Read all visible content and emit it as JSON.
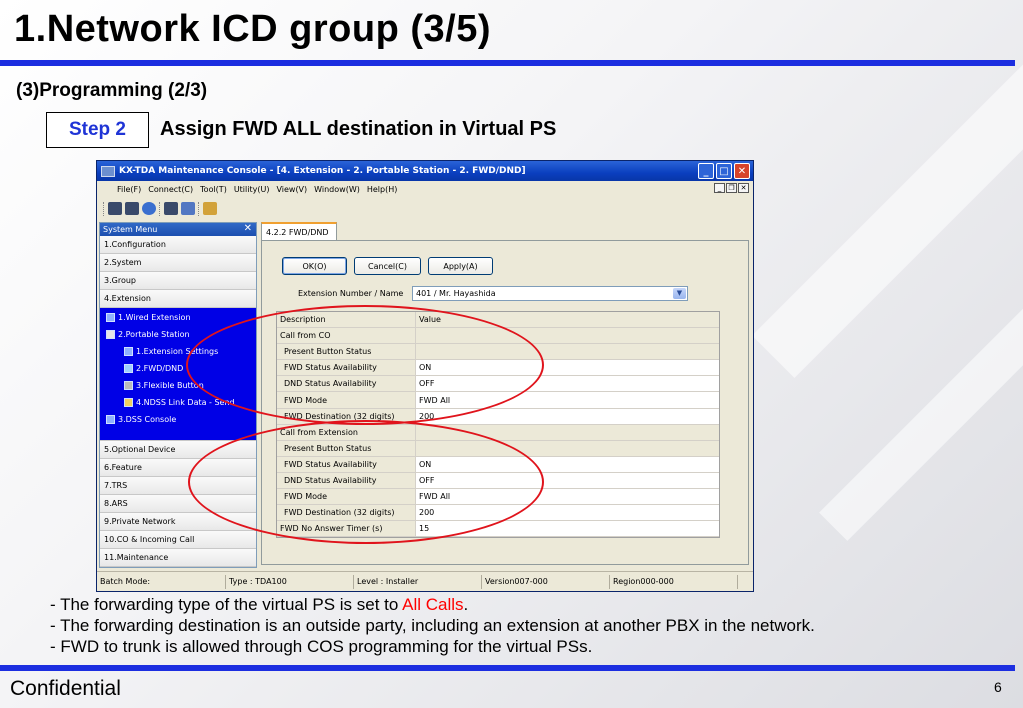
{
  "slide": {
    "title": "1.Network ICD group (3/5)",
    "subtitle": "(3)Programming (2/3)",
    "step_label": "Step 2",
    "step_text": "Assign FWD ALL destination in Virtual PS",
    "note_1_prefix": "- The forwarding type of the virtual PS is set to ",
    "note_1_highlight": "All Calls",
    "note_1_suffix": ".",
    "note_2": "- The forwarding destination is an outside party, including an extension at another PBX in the network.",
    "note_3": "- FWD to trunk is allowed through COS programming for the virtual PSs.",
    "footer": "Confidential",
    "page_number": "6",
    "accent_color": "#1c2ee0",
    "highlight_color": "#ff0000"
  },
  "window": {
    "title": "KX-TDA Maintenance Console - [4. Extension - 2. Portable Station - 2. FWD/DND]",
    "menu": [
      "File(F)",
      "Connect(C)",
      "Tool(T)",
      "Utility(U)",
      "View(V)",
      "Window(W)",
      "Help(H)"
    ],
    "toolbar_icons": [
      "connect-icon",
      "disconnect-icon",
      "settings-icon",
      "save-icon",
      "user-icon",
      "exit-icon"
    ]
  },
  "sidebar": {
    "header": "System Menu",
    "items_top": [
      "1.Configuration",
      "2.System",
      "3.Group",
      "4.Extension"
    ],
    "tree": {
      "wired": "1.Wired Extension",
      "portable": "2.Portable Station",
      "ext_settings": "1.Extension Settings",
      "fwd_dnd": "2.FWD/DND",
      "flexible": "3.Flexible Button",
      "ndss": "4.NDSS Link Data - Send",
      "dss": "3.DSS Console"
    },
    "items_bottom": [
      "5.Optional Device",
      "6.Feature",
      "7.TRS",
      "8.ARS",
      "9.Private Network",
      "10.CO & Incoming Call",
      "11.Maintenance"
    ]
  },
  "content": {
    "tab": "4.2.2 FWD/DND",
    "ok": "OK(O)",
    "cancel": "Cancel(C)",
    "apply": "Apply(A)",
    "ext_label": "Extension Number / Name",
    "ext_value": "401 / Mr. Hayashida",
    "grid_headers": {
      "description": "Description",
      "value": "Value"
    },
    "rows": [
      {
        "d": "Call from CO",
        "v": "",
        "kind": "group"
      },
      {
        "d": "Present Button Status",
        "v": "",
        "kind": "sub"
      },
      {
        "d": "FWD Status Availability",
        "v": "ON",
        "kind": "item"
      },
      {
        "d": "DND Status Availability",
        "v": "OFF",
        "kind": "item"
      },
      {
        "d": "FWD Mode",
        "v": "FWD All",
        "kind": "item"
      },
      {
        "d": "FWD Destination (32 digits)",
        "v": "200",
        "kind": "item"
      },
      {
        "d": "Call from Extension",
        "v": "",
        "kind": "group"
      },
      {
        "d": "Present Button Status",
        "v": "",
        "kind": "sub"
      },
      {
        "d": "FWD Status Availability",
        "v": "ON",
        "kind": "item"
      },
      {
        "d": "DND Status Availability",
        "v": "OFF",
        "kind": "item"
      },
      {
        "d": "FWD Mode",
        "v": "FWD All",
        "kind": "item"
      },
      {
        "d": "FWD Destination (32 digits)",
        "v": "200",
        "kind": "item"
      },
      {
        "d": "FWD No Answer Timer (s)",
        "v": "15",
        "kind": "item"
      }
    ]
  },
  "status": {
    "batch": "Batch Mode:",
    "type": "Type : TDA100",
    "level": "Level : Installer",
    "version": "Version007-000",
    "region": "Region000-000"
  }
}
